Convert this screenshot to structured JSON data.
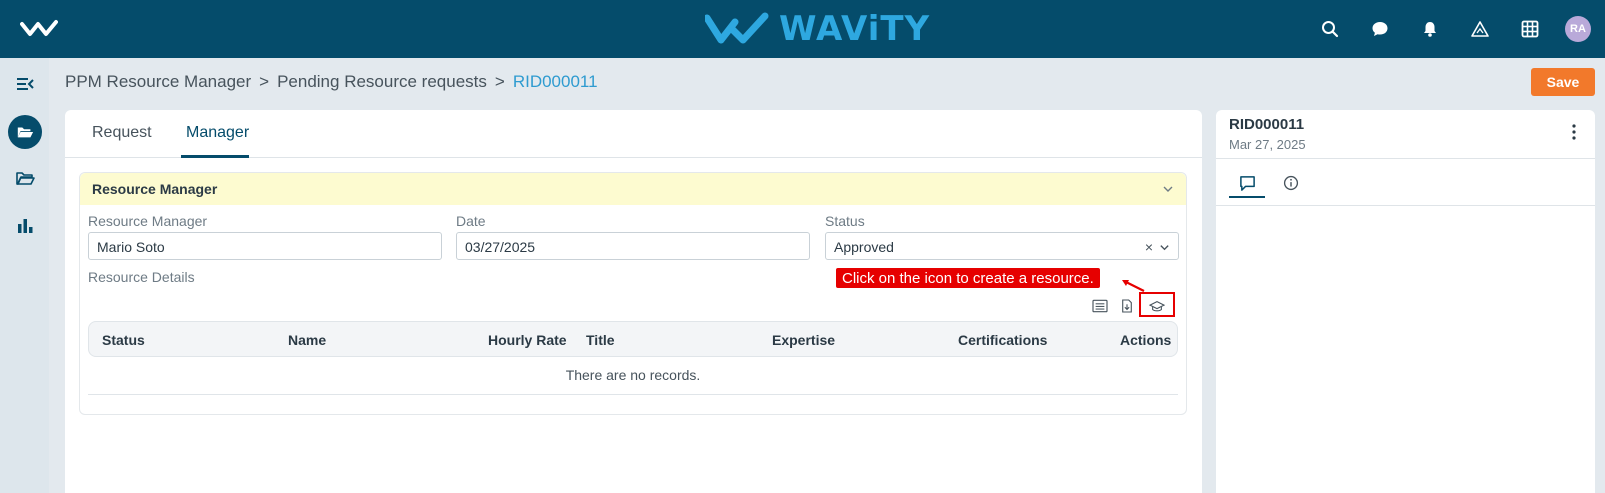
{
  "app": {
    "brand": "WAViTY",
    "avatar_initials": "RA"
  },
  "topbar": {
    "icons": [
      "search-icon",
      "chat-icon",
      "bell-icon",
      "apps-triangle-icon",
      "grid-icon"
    ]
  },
  "rail": {
    "icons": [
      "collapse-menu-icon",
      "folder-open-icon",
      "folder-icon",
      "bar-chart-icon"
    ]
  },
  "breadcrumb": {
    "items": [
      "PPM Resource Manager",
      "Pending Resource requests",
      "RID000011"
    ],
    "separator": ">"
  },
  "toolbar": {
    "save_label": "Save"
  },
  "tabs": [
    "Request",
    "Manager"
  ],
  "active_tab": "Manager",
  "section": {
    "title": "Resource Manager",
    "fields": {
      "resource_manager": {
        "label": "Resource Manager",
        "value": "Mario Soto"
      },
      "date": {
        "label": "Date",
        "value": "03/27/2025"
      },
      "status": {
        "label": "Status",
        "value": "Approved",
        "clear": "×"
      }
    },
    "resource_details_label": "Resource Details"
  },
  "tooltip": {
    "text": "Click on the icon to create a resource."
  },
  "table": {
    "columns": [
      "Status",
      "Name",
      "Hourly Rate",
      "Title",
      "Expertise",
      "Certifications",
      "Actions"
    ],
    "empty_text": "There are no records."
  },
  "right_panel": {
    "title": "RID000011",
    "date": "Mar 27, 2025",
    "tabs": [
      "comment-icon",
      "info-icon"
    ]
  },
  "colors": {
    "topbar": "#054c6b",
    "brand": "#2ea8e0",
    "accent_button": "#f2792b",
    "section_header": "#fdfbd0",
    "tooltip": "#e60000",
    "link": "#2e9bd0"
  }
}
